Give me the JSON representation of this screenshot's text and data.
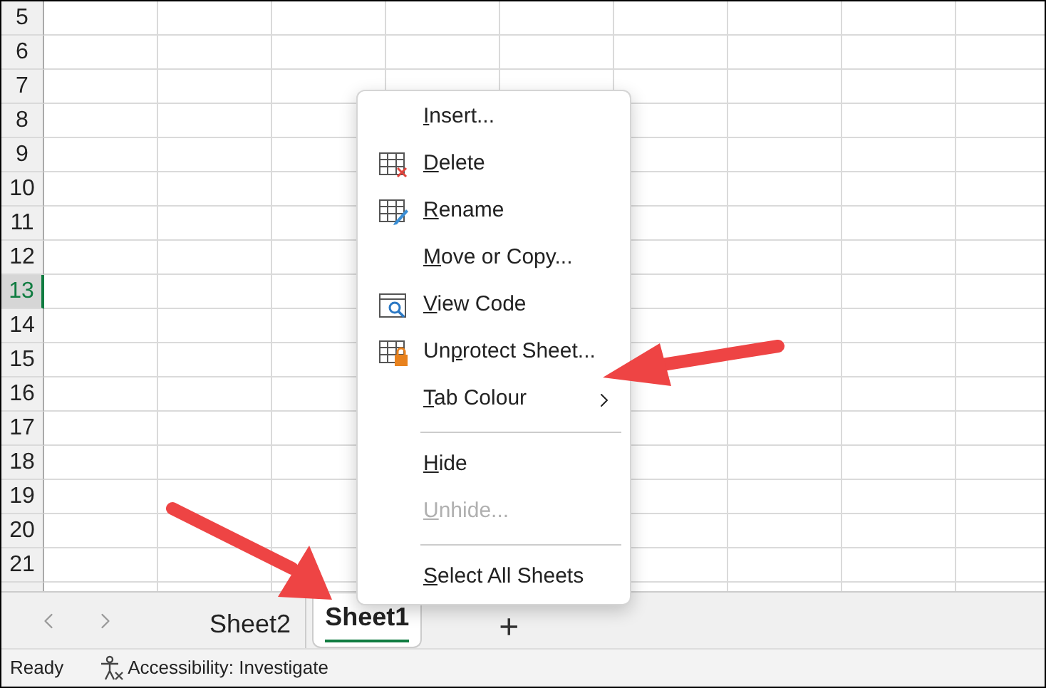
{
  "rows": [
    {
      "label": "5",
      "selected": false
    },
    {
      "label": "6",
      "selected": false
    },
    {
      "label": "7",
      "selected": false
    },
    {
      "label": "8",
      "selected": false
    },
    {
      "label": "9",
      "selected": false
    },
    {
      "label": "10",
      "selected": false
    },
    {
      "label": "11",
      "selected": false
    },
    {
      "label": "12",
      "selected": false
    },
    {
      "label": "13",
      "selected": true
    },
    {
      "label": "14",
      "selected": false
    },
    {
      "label": "15",
      "selected": false
    },
    {
      "label": "16",
      "selected": false
    },
    {
      "label": "17",
      "selected": false
    },
    {
      "label": "18",
      "selected": false
    },
    {
      "label": "19",
      "selected": false
    },
    {
      "label": "20",
      "selected": false
    },
    {
      "label": "21",
      "selected": false
    }
  ],
  "context_menu": {
    "items": [
      {
        "kind": "plain",
        "key": "I",
        "post": "nsert...",
        "disabled": false
      },
      {
        "kind": "delete",
        "key": "D",
        "post": "elete",
        "disabled": false
      },
      {
        "kind": "rename",
        "key": "R",
        "post": "ename",
        "disabled": false
      },
      {
        "kind": "plain",
        "key": "M",
        "post": "ove or Copy...",
        "disabled": false
      },
      {
        "kind": "code",
        "key": "V",
        "post": "iew Code",
        "disabled": false
      },
      {
        "kind": "lock",
        "pre": "Un",
        "key": "p",
        "post": "rotect Sheet...",
        "disabled": false
      },
      {
        "kind": "submenu",
        "key": "T",
        "post": "ab Colour",
        "disabled": false
      },
      {
        "kind": "separator"
      },
      {
        "kind": "plain",
        "key": "H",
        "post": "ide",
        "disabled": false
      },
      {
        "kind": "plain",
        "key": "U",
        "post": "nhide...",
        "disabled": true
      },
      {
        "kind": "separator"
      },
      {
        "kind": "plain",
        "key": "S",
        "post": "elect All Sheets",
        "disabled": false
      }
    ]
  },
  "sheet_tabs": [
    {
      "label": "Sheet2",
      "selected": false
    },
    {
      "label": "Sheet1",
      "selected": true
    }
  ],
  "new_sheet": "+",
  "status_bar": {
    "ready": "Ready",
    "accessibility": "Accessibility: Investigate"
  }
}
